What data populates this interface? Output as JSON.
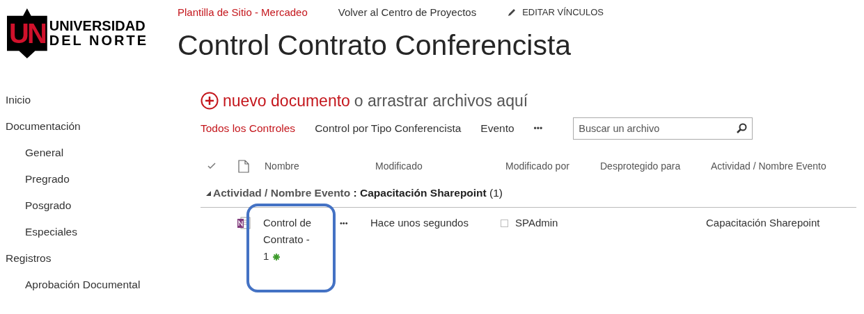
{
  "logo": {
    "mark": "UN",
    "line1": "UNIVERSIDAD",
    "line2": "DEL NORTE"
  },
  "top_links": [
    {
      "label": "Plantilla de Sitio - Mercadeo",
      "selected": true
    },
    {
      "label": "Volver al Centro de Proyectos",
      "selected": false
    }
  ],
  "edit_links": "EDITAR VÍNCULOS",
  "title": "Control Contrato Conferencista",
  "sidebar": {
    "items": [
      {
        "label": "Inicio"
      },
      {
        "label": "Documentación",
        "children": [
          {
            "label": "General"
          },
          {
            "label": "Pregrado"
          },
          {
            "label": "Posgrado"
          },
          {
            "label": "Especiales"
          }
        ]
      },
      {
        "label": "Registros",
        "children": [
          {
            "label": "Aprobación Documental"
          }
        ]
      }
    ]
  },
  "new_document": {
    "action": "nuevo documento",
    "rest": "o arrastrar archivos aquí"
  },
  "views": [
    {
      "label": "Todos los Controles",
      "selected": true
    },
    {
      "label": "Control por Tipo Conferencista",
      "selected": false
    },
    {
      "label": "Evento",
      "selected": false
    }
  ],
  "more_views": "•••",
  "search": {
    "placeholder": "Buscar un archivo"
  },
  "table": {
    "columns": [
      "Nombre",
      "Modificado",
      "Modificado por",
      "Desprotegido para",
      "Actividad / Nombre Evento"
    ],
    "group": {
      "field": "Actividad / Nombre Evento",
      "separator": " : ",
      "value": "Capacitación Sharepoint",
      "count": "(1)",
      "expanded": true
    },
    "rows": [
      {
        "name": "Control de Contrato - 1",
        "is_new": true,
        "highlighted": true,
        "menu": "•••",
        "modified": "Hace unos segundos",
        "checked": false,
        "modified_by": "SPAdmin",
        "activity": "Capacitación Sharepoint"
      }
    ]
  }
}
